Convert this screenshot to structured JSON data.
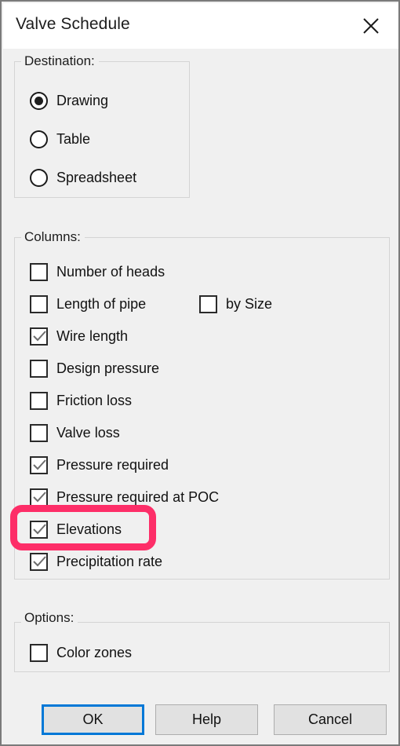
{
  "window": {
    "title": "Valve Schedule",
    "close_icon": "close-icon"
  },
  "destination": {
    "legend": "Destination:",
    "options": [
      {
        "label": "Drawing",
        "selected": true
      },
      {
        "label": "Table",
        "selected": false
      },
      {
        "label": "Spreadsheet",
        "selected": false
      }
    ]
  },
  "columns": {
    "legend": "Columns:",
    "items": [
      {
        "label": "Number of heads",
        "checked": false
      },
      {
        "label": "Length of pipe",
        "checked": false
      },
      {
        "label": "Wire length",
        "checked": true
      },
      {
        "label": "Design pressure",
        "checked": false
      },
      {
        "label": "Friction loss",
        "checked": false
      },
      {
        "label": "Valve loss",
        "checked": false
      },
      {
        "label": "Pressure required",
        "checked": true
      },
      {
        "label": "Pressure required at POC",
        "checked": true
      },
      {
        "label": "Elevations",
        "checked": true
      },
      {
        "label": "Precipitation rate",
        "checked": true
      }
    ],
    "by_size": {
      "label": "by Size",
      "checked": false
    }
  },
  "options": {
    "legend": "Options:",
    "items": [
      {
        "label": "Color zones",
        "checked": false
      }
    ]
  },
  "buttons": {
    "ok": "OK",
    "help": "Help",
    "cancel": "Cancel"
  },
  "annotation": {
    "target": "Elevations",
    "color": "#fd2e68"
  }
}
